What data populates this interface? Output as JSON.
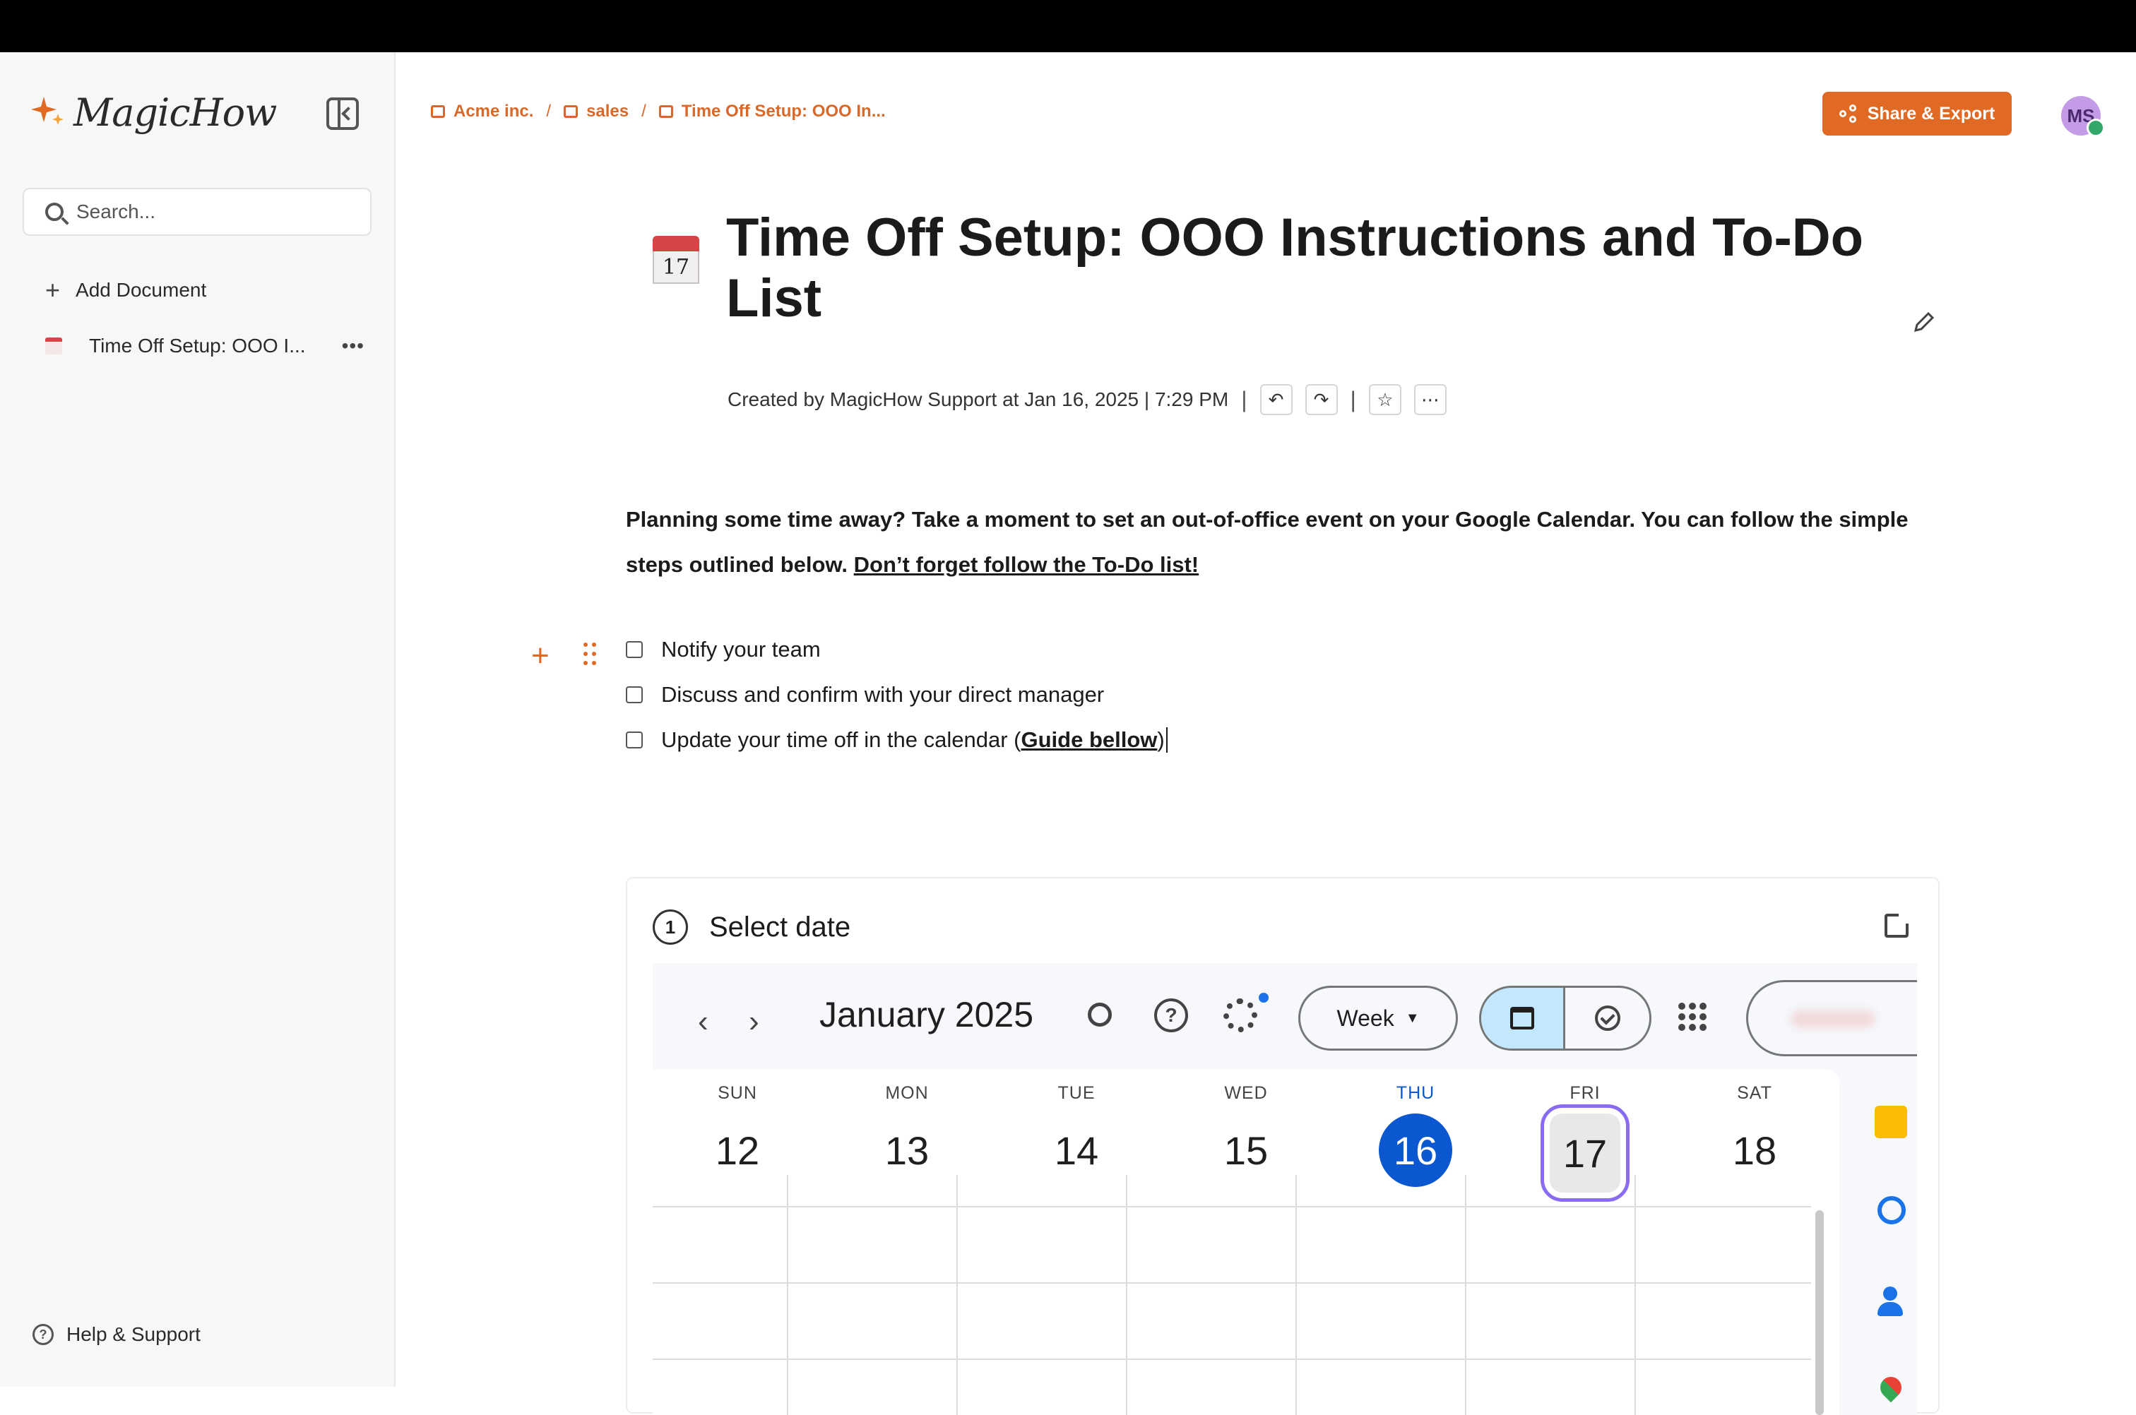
{
  "app": {
    "name": "MagicHow",
    "search_placeholder": "Search...",
    "add_document_label": "Add Document",
    "documents": [
      {
        "label": "Time Off Setup: OOO I..."
      }
    ],
    "help_label": "Help & Support"
  },
  "header": {
    "breadcrumb": [
      "Acme inc.",
      "sales",
      "Time Off Setup: OOO In..."
    ],
    "share_label": "Share & Export",
    "avatar_initials": "MS"
  },
  "document": {
    "icon_day": "17",
    "title": "Time Off Setup: OOO Instructions and To-Do List",
    "meta": "Created by MagicHow Support at Jan 16, 2025 | 7:29 PM",
    "intro": "Planning some time away?  Take a moment to set an out-of-office event on your Google Calendar. You can follow the simple steps outlined below.",
    "intro_link": "Don’t forget follow the To-Do list!",
    "todos": [
      {
        "text": "Notify your team",
        "checked": false
      },
      {
        "text": "Discuss and confirm with your direct manager",
        "checked": false
      },
      {
        "text": "Update your time off in the calendar (",
        "link": "Guide bellow",
        "suffix": ")",
        "checked": false
      }
    ]
  },
  "step": {
    "number": "1",
    "title": "Select date",
    "calendar": {
      "month": "January 2025",
      "view": "Week",
      "days": [
        {
          "dow": "SUN",
          "num": "12"
        },
        {
          "dow": "MON",
          "num": "13"
        },
        {
          "dow": "TUE",
          "num": "14"
        },
        {
          "dow": "WED",
          "num": "15"
        },
        {
          "dow": "THU",
          "num": "16"
        },
        {
          "dow": "FRI",
          "num": "17"
        },
        {
          "dow": "SAT",
          "num": "18"
        }
      ]
    }
  },
  "colors": {
    "accent": "#e06a24",
    "today": "#0b57d0",
    "selection": "#8a6cf0"
  }
}
